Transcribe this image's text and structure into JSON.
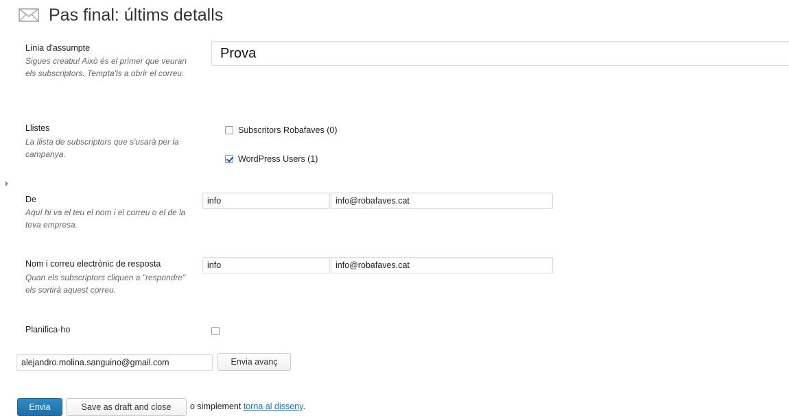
{
  "header": {
    "title": "Pas final: últims detalls",
    "icon": "envelope-icon"
  },
  "subject": {
    "label": "Línia d'assumpte",
    "description": "Sigues creatiu! Això és el primer que veuran els subscriptors. Tempta'ls a obrir el correu.",
    "value": "Prova"
  },
  "lists": {
    "label": "Llistes",
    "description": "La llista de subscriptors que s'usarà per la campanya.",
    "items": [
      {
        "label": "Subscritors Robafaves (0)",
        "checked": false
      },
      {
        "label": "WordPress Users (1)",
        "checked": true
      }
    ]
  },
  "from": {
    "label": "De",
    "description": "Aquí hi va el teu el nom i el correu o el de la teva empresa.",
    "name_value": "info",
    "email_value": "info@robafaves.cat"
  },
  "reply_to": {
    "label": "Nom i correu electrònic de resposta",
    "description": "Quan els subscriptors cliquen a \"respondre\" els sortirà aquest correu.",
    "name_value": "info",
    "email_value": "info@robafaves.cat"
  },
  "schedule": {
    "label": "Planifica-ho",
    "checked": false
  },
  "preview": {
    "email_value": "alejandro.molina.sanguino@gmail.com",
    "button_label": "Envia avanç"
  },
  "actions": {
    "send_label": "Envia",
    "draft_label": "Save as draft and close",
    "or_text": "o simplement",
    "back_link": "torna al disseny",
    "period": "."
  },
  "colors": {
    "primary_button": "#2476b1",
    "link": "#1e6fb8"
  }
}
